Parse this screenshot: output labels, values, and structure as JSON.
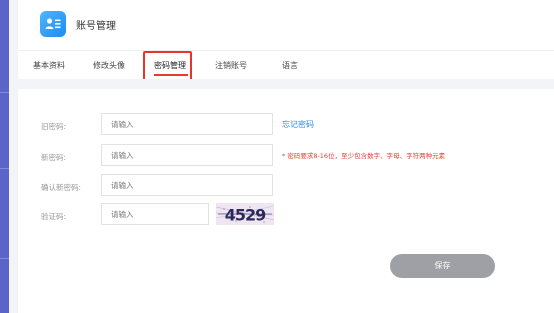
{
  "header": {
    "title": "账号管理",
    "icon": "user-card-icon"
  },
  "tabs": [
    {
      "label": "基本资料",
      "active": false
    },
    {
      "label": "修改头像",
      "active": false
    },
    {
      "label": "密码管理",
      "active": true
    },
    {
      "label": "注销账号",
      "active": false
    },
    {
      "label": "语言",
      "active": false
    }
  ],
  "form": {
    "old_password": {
      "label": "旧密码:",
      "placeholder": "请输入"
    },
    "forgot_link": "忘记密码",
    "new_password": {
      "label": "新密码:",
      "placeholder": "请输入"
    },
    "new_password_hint": "* 密码要求8-16位，至少包含数字、字母、字符两种元素",
    "confirm_password": {
      "label": "确认新密码:",
      "placeholder": "请输入"
    },
    "captcha": {
      "label": "验证码:",
      "placeholder": "请输入",
      "code": "4529"
    },
    "save_label": "保存"
  },
  "colors": {
    "accent_red": "#e23b32",
    "link_blue": "#2f8ae6",
    "save_gray": "#9ea0a6",
    "rail_purple": "#5b64c9"
  }
}
